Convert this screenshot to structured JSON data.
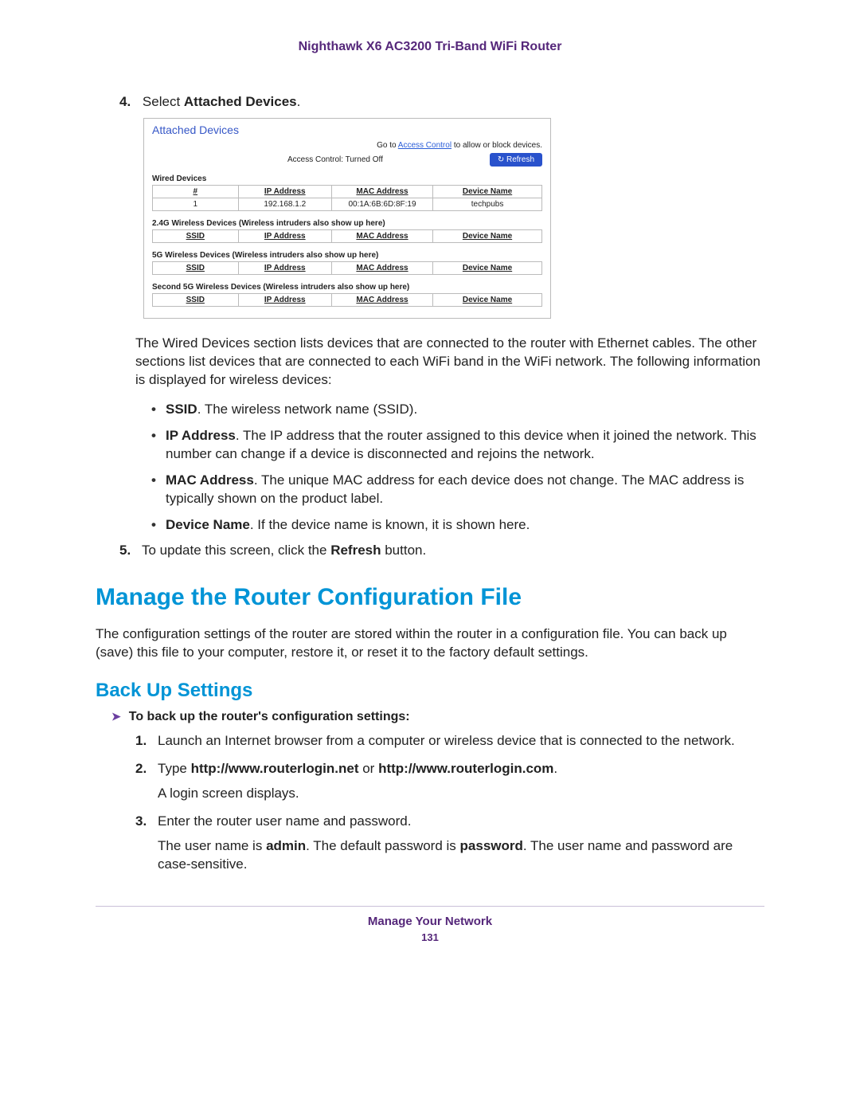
{
  "header": {
    "title": "Nighthawk X6 AC3200 Tri-Band WiFi Router"
  },
  "step4": {
    "num": "4.",
    "prefix": "Select ",
    "bold": "Attached Devices",
    "suffix": "."
  },
  "shot": {
    "title": "Attached Devices",
    "go_to": "Go to ",
    "ac_link": "Access Control",
    "go_to_suffix": " to allow or block devices.",
    "ac_status": "Access Control: Turned Off",
    "refresh": "Refresh",
    "wired_label": "Wired Devices",
    "wired_headers": {
      "num": "#",
      "ip": "IP Address",
      "mac": "MAC Address",
      "dev": "Device Name"
    },
    "wired_row": {
      "num": "1",
      "ip": "192.168.1.2",
      "mac": "00:1A:6B:6D:8F:19",
      "dev": "techpubs"
    },
    "g24_label": "2.4G Wireless Devices (Wireless intruders also show up here)",
    "g5_label": "5G Wireless Devices (Wireless intruders also show up here)",
    "g5b_label": "Second 5G Wireless Devices (Wireless intruders also show up here)",
    "wl_headers": {
      "ssid": "SSID",
      "ip": "IP Address",
      "mac": "MAC Address",
      "dev": "Device Name"
    }
  },
  "para1": "The Wired Devices section lists devices that are connected to the router with Ethernet cables. The other sections list devices that are connected to each WiFi band in the WiFi network. The following information is displayed for wireless devices:",
  "bullets": {
    "ssid_b": "SSID",
    "ssid_t": ". The wireless network name (SSID).",
    "ip_b": "IP Address",
    "ip_t": ". The IP address that the router assigned to this device when it joined the network. This number can change if a device is disconnected and rejoins the network.",
    "mac_b": "MAC Address",
    "mac_t": ". The unique MAC address for each device does not change. The MAC address is typically shown on the product label.",
    "dev_b": "Device Name",
    "dev_t": ". If the device name is known, it is shown here."
  },
  "step5": {
    "num": "5.",
    "pre": "To update this screen, click the ",
    "bold": "Refresh",
    "post": " button."
  },
  "h1": "Manage the Router Configuration File",
  "config_para": "The configuration settings of the router are stored within the router in a configuration file. You can back up (save) this file to your computer, restore it, or reset it to the factory default settings.",
  "h2": "Back Up Settings",
  "proc_title": "To back up the router's configuration settings:",
  "steps": {
    "s1": {
      "num": "1.",
      "text": "Launch an Internet browser from a computer or wireless device that is connected to the network."
    },
    "s2": {
      "num": "2.",
      "pre": "Type ",
      "b1": "http://www.routerlogin.net",
      "mid": " or ",
      "b2": "http://www.routerlogin.com",
      "post": ".",
      "sub": "A login screen displays."
    },
    "s3": {
      "num": "3.",
      "text": "Enter the router user name and password.",
      "sub_pre": "The user name is ",
      "sub_b1": "admin",
      "sub_mid": ". The default password is ",
      "sub_b2": "password",
      "sub_post": ". The user name and password are case-sensitive."
    }
  },
  "footer": {
    "chapter": "Manage Your Network",
    "page": "131"
  }
}
